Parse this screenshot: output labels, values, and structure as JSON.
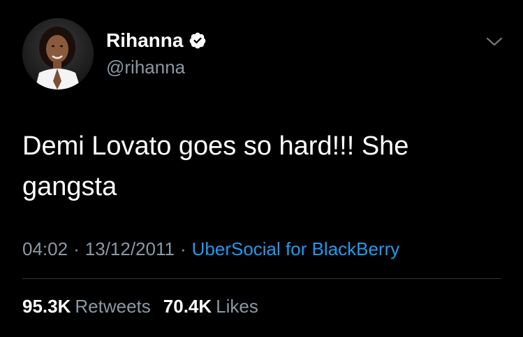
{
  "author": {
    "display_name": "Rihanna",
    "handle": "@rihanna",
    "verified": true,
    "avatar_icon": "profile-photo"
  },
  "tweet": {
    "text": "Demi Lovato goes so hard!!! She gangsta",
    "time": "04:02",
    "date": "13/12/2011",
    "separator": "·",
    "source": "UberSocial for BlackBerry"
  },
  "stats": {
    "retweets_count": "95.3K",
    "retweets_label": "Retweets",
    "likes_count": "70.4K",
    "likes_label": "Likes"
  },
  "colors": {
    "background": "#000000",
    "text": "#ffffff",
    "secondary_text": "#8b98a5",
    "link": "#1d9bf0",
    "verified_badge": "#ffffff"
  }
}
